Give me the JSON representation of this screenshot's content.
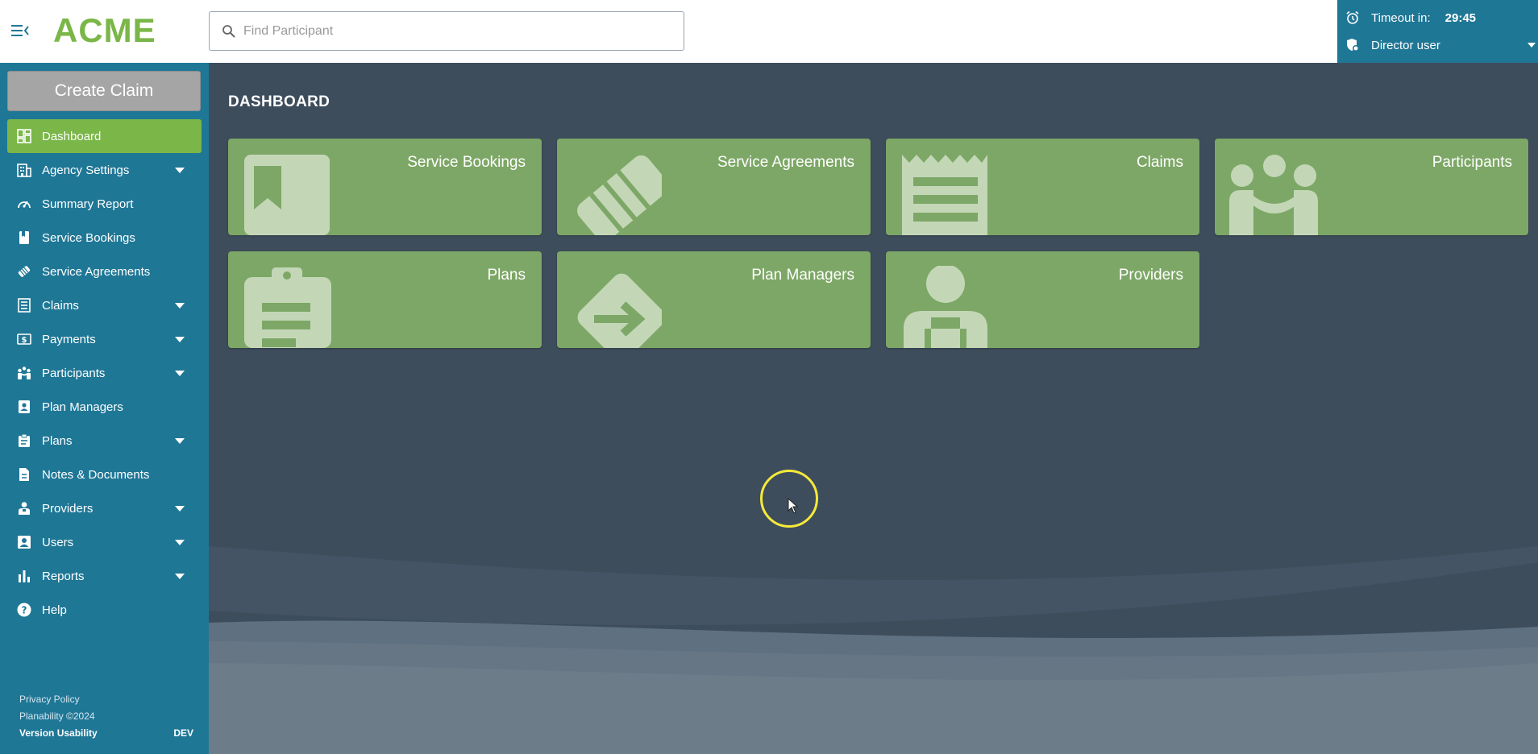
{
  "header": {
    "logo": "ACME",
    "search_placeholder": "Find Participant",
    "timeout_label": "Timeout in:",
    "timeout_value": "29:45",
    "user_name": "Director user"
  },
  "sidebar": {
    "create_claim_label": "Create Claim",
    "items": [
      {
        "label": "Dashboard",
        "icon": "dashboard-icon",
        "active": true,
        "has_caret": false
      },
      {
        "label": "Agency Settings",
        "icon": "building-icon",
        "has_caret": true
      },
      {
        "label": "Summary Report",
        "icon": "gauge-icon",
        "has_caret": false
      },
      {
        "label": "Service Bookings",
        "icon": "bookmark-icon",
        "has_caret": false
      },
      {
        "label": "Service Agreements",
        "icon": "handshake-icon",
        "has_caret": false
      },
      {
        "label": "Claims",
        "icon": "receipt-icon",
        "has_caret": true
      },
      {
        "label": "Payments",
        "icon": "dollar-icon",
        "has_caret": true
      },
      {
        "label": "Participants",
        "icon": "people-icon",
        "has_caret": true
      },
      {
        "label": "Plan Managers",
        "icon": "id-card-icon",
        "has_caret": false
      },
      {
        "label": "Plans",
        "icon": "clipboard-icon",
        "has_caret": true
      },
      {
        "label": "Notes & Documents",
        "icon": "document-icon",
        "has_caret": false
      },
      {
        "label": "Providers",
        "icon": "worker-icon",
        "has_caret": true
      },
      {
        "label": "Users",
        "icon": "user-card-icon",
        "has_caret": true
      },
      {
        "label": "Reports",
        "icon": "bar-chart-icon",
        "has_caret": true
      },
      {
        "label": "Help",
        "icon": "help-icon",
        "has_caret": false
      }
    ],
    "footer": {
      "privacy": "Privacy Policy",
      "copyright": "Planability ©2024",
      "version": "Version Usability",
      "env": "DEV"
    }
  },
  "main": {
    "title": "DASHBOARD",
    "tiles": [
      {
        "label": "Service Bookings",
        "icon": "bookmark-icon"
      },
      {
        "label": "Service Agreements",
        "icon": "handshake-icon"
      },
      {
        "label": "Claims",
        "icon": "receipt-icon"
      },
      {
        "label": "Participants",
        "icon": "people-icon"
      },
      {
        "label": "Plans",
        "icon": "clipboard-icon"
      },
      {
        "label": "Plan Managers",
        "icon": "diamond-arrow-icon"
      },
      {
        "label": "Providers",
        "icon": "worker-icon"
      }
    ]
  },
  "colors": {
    "brand_green": "#7ab648",
    "tile_green": "#7da766",
    "sidebar_blue": "#1f7796",
    "main_bg": "#3e4d5c"
  }
}
